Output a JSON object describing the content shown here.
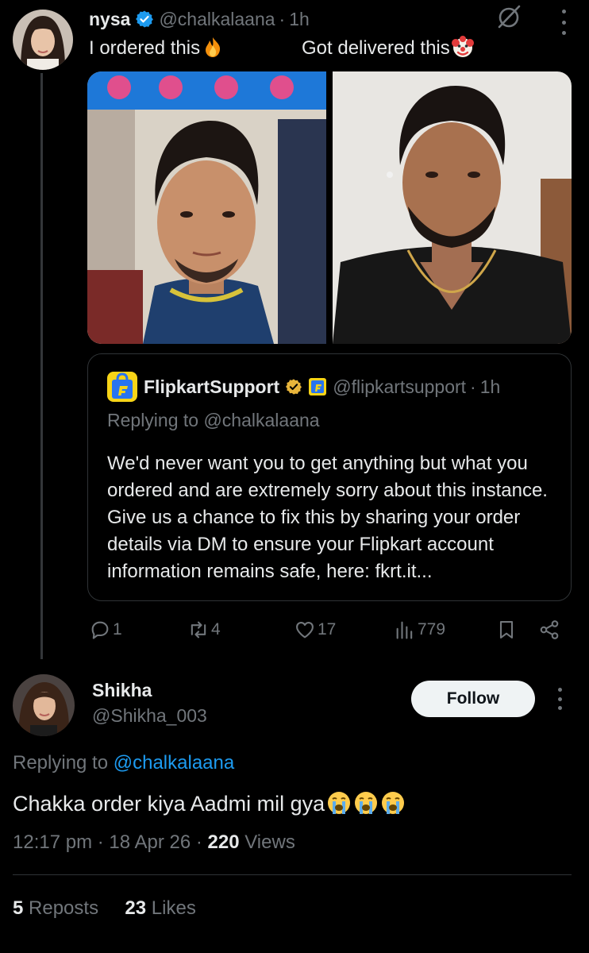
{
  "post": {
    "name": "nysa",
    "handle": "@chalkalaana",
    "separator": "·",
    "time": "1h",
    "caption_left": "I ordered this",
    "caption_right": "Got delivered this"
  },
  "quote": {
    "name": "FlipkartSupport",
    "handle": "@flipkartsupport",
    "separator": "·",
    "time": "1h",
    "replying": "Replying to @chalkalaana",
    "body": "We'd never want you to get anything but what you ordered and are extremely sorry about this instance. Give us a chance to fix this by sharing your order details via DM to ensure your Flipkart account information remains safe, here: fkrt.it..."
  },
  "actions": {
    "replies": "1",
    "reposts": "4",
    "likes": "17",
    "views": "779"
  },
  "reply": {
    "name": "Shikha",
    "handle": "@Shikha_003",
    "follow_label": "Follow",
    "replying_prefix": "Replying to",
    "replying_mention": "@chalkalaana",
    "text": "Chakka order kiya Aadmi mil gya",
    "time": "12:17 pm",
    "sep1": "·",
    "date": "18 Apr 26",
    "sep2": "·",
    "views_count": "220",
    "views_label": "Views",
    "reposts_count": "5",
    "reposts_label": "Reposts",
    "likes_count": "23",
    "likes_label": "Likes"
  },
  "icons": {
    "verified": "verified-badge-icon",
    "grok": "grok-icon",
    "more": "more-vertical-icon",
    "fire": "fire-emoji",
    "clown": "clown-emoji",
    "crying": "loudly-crying-emoji",
    "reply": "reply-icon",
    "repost": "repost-icon",
    "like": "heart-icon",
    "views": "views-icon",
    "bookmark": "bookmark-icon",
    "share": "share-icon"
  },
  "colors": {
    "background": "#000000",
    "text": "#e7e9ea",
    "muted": "#71767b",
    "accent": "#1d9bf0",
    "border": "#2f3336",
    "gold_badge": "#e8b53b"
  }
}
